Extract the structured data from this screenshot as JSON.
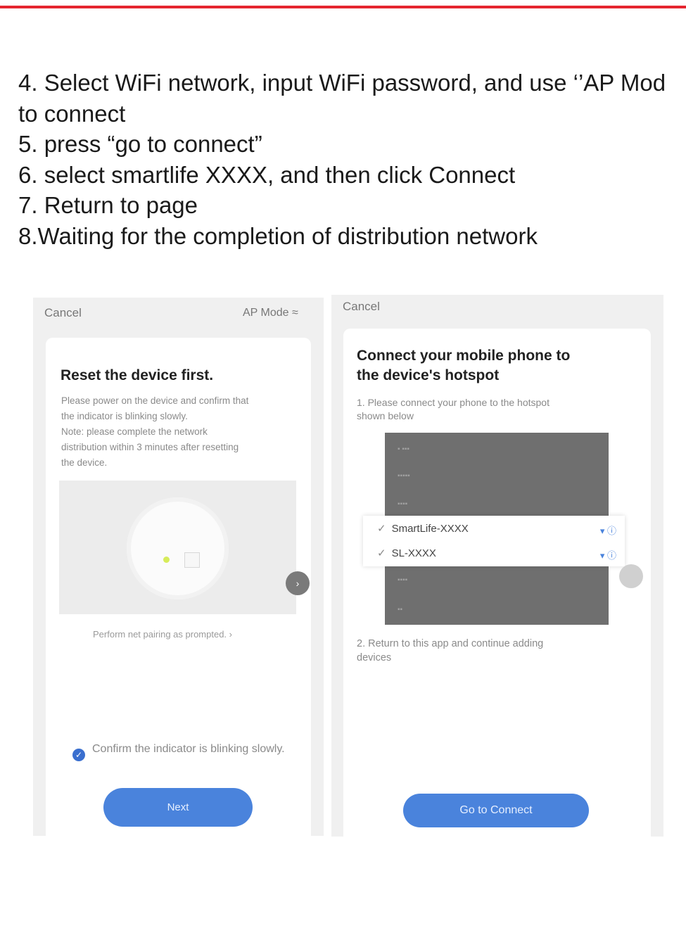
{
  "instructions": [
    "4. Select WiFi network, input WiFi password, and use ‘’AP Mode’’ to connect",
    "5. press “go to connect”",
    "6. select smartlife XXXX, and then click Connect",
    "7. Return to page",
    "8.Waiting for the completion of distribution network"
  ],
  "instruction_display": {
    "line1": "4. Select WiFi network, input WiFi password, and use ‘’AP Mod",
    "line2": "to connect"
  },
  "screen1": {
    "cancel": "Cancel",
    "mode": "AP Mode ≈",
    "title": "Reset the device first.",
    "desc1": "Please power on the device and confirm that",
    "desc2": "the indicator is blinking slowly.",
    "desc3": "Note: please complete the network",
    "desc4": "distribution within 3 minutes after resetting",
    "desc5": "the device.",
    "perform": "Perform net pairing as prompted. ›",
    "confirm": "Confirm the indicator is blinking slowly.",
    "next": "Next"
  },
  "screen2": {
    "cancel": "Cancel",
    "title1": "Connect your mobile phone to",
    "title2": "the device's hotspot",
    "step1a": "1. Please connect your phone to the hotspot",
    "step1b": "shown below",
    "wifi1": "SmartLife-XXXX",
    "wifi2": "SL-XXXX",
    "step2a": "2. Return to this app and continue adding",
    "step2b": "devices",
    "go": "Go to Connect"
  },
  "colors": {
    "accent": "#4a83dc",
    "brand_red": "#e52630"
  }
}
